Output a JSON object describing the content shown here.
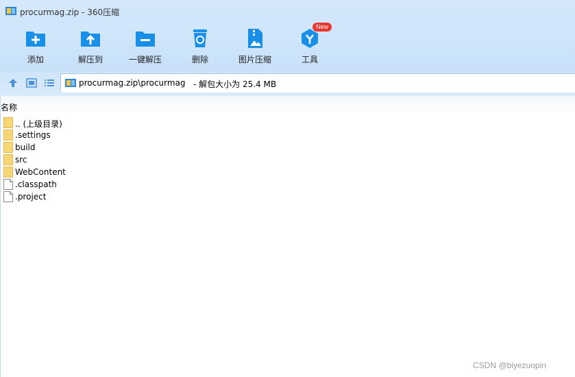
{
  "window": {
    "title": "procurmag.zip - 360压缩"
  },
  "toolbar": {
    "items": [
      {
        "label": "添加",
        "icon": "add-folder-icon"
      },
      {
        "label": "解压到",
        "icon": "extract-to-icon"
      },
      {
        "label": "一键解压",
        "icon": "one-click-extract-icon"
      },
      {
        "label": "删除",
        "icon": "trash-icon"
      },
      {
        "label": "图片压缩",
        "icon": "image-compress-icon"
      },
      {
        "label": "工具",
        "icon": "tools-icon",
        "badge": "New"
      }
    ]
  },
  "address": {
    "path": "procurmag.zip\\procurmag",
    "info": "- 解包大小为 25.4 MB"
  },
  "list": {
    "column_name": "名称",
    "rows": [
      {
        "name": ".. (上级目录)",
        "type": "folder"
      },
      {
        "name": ".settings",
        "type": "folder"
      },
      {
        "name": "build",
        "type": "folder"
      },
      {
        "name": "src",
        "type": "folder"
      },
      {
        "name": "WebContent",
        "type": "folder"
      },
      {
        "name": ".classpath",
        "type": "file"
      },
      {
        "name": ".project",
        "type": "file"
      }
    ]
  },
  "watermark": "CSDN @biyezuopin",
  "colors": {
    "accent": "#1a8fe8",
    "badge": "#e8352e",
    "folder": "#f7d675"
  }
}
